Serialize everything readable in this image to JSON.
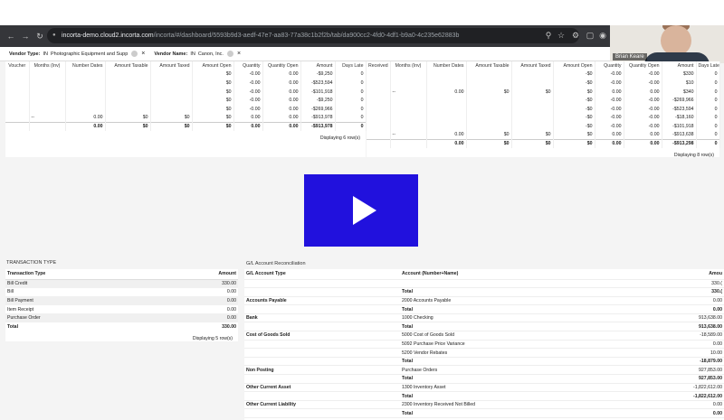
{
  "browser": {
    "url_host": "incorta-demo.cloud2.incorta.com",
    "url_path": "/incorta/#/dashboard/5593b9d3-aedf-47e7-aa83-77a38c1b2f2b/tab/da900cc2-4fd0-4df1-b9a0-4c235e62883b",
    "back_icon": "←",
    "forward_icon": "→",
    "reload_icon": "↻"
  },
  "video": {
    "participant_name": "Brian Keare"
  },
  "filters": [
    {
      "label": "Vendor Type:",
      "operator": "IN",
      "value": "Photographic Equipment and Supp"
    },
    {
      "label": "Vendor Name:",
      "operator": "IN",
      "value": "Canon, Inc."
    }
  ],
  "top_left_table": {
    "headers": [
      "Voucher",
      "Months (Inv)",
      "Number Dates",
      "Amount Taxable",
      "Amount Taxed",
      "Amount Open",
      "Quantity",
      "Quantity Open",
      "Amount",
      "Days Late"
    ],
    "rows": [
      [
        "",
        "",
        "",
        "",
        "",
        "$0",
        "-0.00",
        "0.00",
        "-$9,250",
        "0"
      ],
      [
        "",
        "",
        "",
        "",
        "",
        "$0",
        "-0.00",
        "0.00",
        "-$523,594",
        "0"
      ],
      [
        "",
        "",
        "",
        "",
        "",
        "$0",
        "-0.00",
        "0.00",
        "-$101,918",
        "0"
      ],
      [
        "",
        "",
        "",
        "",
        "",
        "$0",
        "-0.00",
        "0.00",
        "-$9,250",
        "0"
      ],
      [
        "",
        "",
        "",
        "",
        "",
        "$0",
        "-0.00",
        "0.00",
        "-$269,966",
        "0"
      ],
      [
        "",
        "--",
        "0.00",
        "$0",
        "$0",
        "$0",
        "0.00",
        "0.00",
        "-$913,978",
        "0"
      ]
    ],
    "total": [
      "",
      "",
      "0.00",
      "$0",
      "$0",
      "$0",
      "0.00",
      "0.00",
      "-$913,978",
      "0"
    ],
    "displaying": "Displaying 6 row(s)"
  },
  "top_right_table": {
    "headers": [
      "Received",
      "Months (Inv)",
      "Number Dates",
      "Amount Taxable",
      "Amount Taxed",
      "Amount Open",
      "Quantity",
      "Quantity Open",
      "Amount",
      "Days Late"
    ],
    "rows": [
      [
        "",
        "",
        "",
        "",
        "",
        "-$0",
        "-0.00",
        "-0.00",
        "$330",
        "0"
      ],
      [
        "",
        "",
        "",
        "",
        "",
        "-$0",
        "-0.00",
        "-0.00",
        "$10",
        "0"
      ],
      [
        "",
        "--",
        "0.00",
        "$0",
        "$0",
        "$0",
        "0.00",
        "0.00",
        "$340",
        "0"
      ],
      [
        "",
        "",
        "",
        "",
        "",
        "-$0",
        "-0.00",
        "-0.00",
        "-$269,966",
        "0"
      ],
      [
        "",
        "",
        "",
        "",
        "",
        "-$0",
        "-0.00",
        "-0.00",
        "-$523,594",
        "0"
      ],
      [
        "",
        "",
        "",
        "",
        "",
        "-$0",
        "-0.00",
        "-0.00",
        "-$18,160",
        "0"
      ],
      [
        "",
        "",
        "",
        "",
        "",
        "-$0",
        "-0.00",
        "-0.00",
        "-$101,918",
        "0"
      ],
      [
        "",
        "--",
        "0.00",
        "$0",
        "$0",
        "$0",
        "0.00",
        "0.00",
        "-$913,638",
        "0"
      ]
    ],
    "total": [
      "",
      "",
      "0.00",
      "$0",
      "$0",
      "$0",
      "0.00",
      "0.00",
      "-$913,298",
      "0"
    ],
    "displaying": "Displaying 8 row(s)"
  },
  "transaction_type": {
    "title": "TRANSACTION TYPE",
    "headers": [
      "Transaction Type",
      "Amount"
    ],
    "rows": [
      [
        "Bill Credit",
        "330.00"
      ],
      [
        "Bill",
        "0.00"
      ],
      [
        "Bill Payment",
        "0.00"
      ],
      [
        "Item Receipt",
        "0.00"
      ],
      [
        "Purchase Order",
        "0.00"
      ]
    ],
    "total": [
      "Total",
      "330.00"
    ],
    "displaying": "Displaying 5 row(s)"
  },
  "gl_recon": {
    "title": "G/L Account Reconciliation",
    "headers": [
      "G/L Account Type",
      "Account (Number+Name)",
      "Amou"
    ],
    "rows": [
      [
        "",
        "",
        "330.("
      ],
      [
        "",
        "Total",
        "330.("
      ],
      [
        "Accounts Payable",
        "2000 Accounts Payable",
        "0.00"
      ],
      [
        "",
        "Total",
        "0.00"
      ],
      [
        "Bank",
        "1000 Checking",
        "913,638.00"
      ],
      [
        "",
        "Total",
        "913,638.00"
      ],
      [
        "Cost of Goods Sold",
        "5000 Cost of Goods Sold",
        "-18,589.00"
      ],
      [
        "",
        "5092 Purchase Price Variance",
        "0.00"
      ],
      [
        "",
        "5200 Vendor Rebates",
        "10.00"
      ],
      [
        "",
        "Total",
        "-18,879.00"
      ],
      [
        "Non Posting",
        "Purchase Orders",
        "927,853.00"
      ],
      [
        "",
        "Total",
        "927,853.00"
      ],
      [
        "Other Current Asset",
        "1300 Inventory Asset",
        "-1,822,612.00"
      ],
      [
        "",
        "Total",
        "-1,822,612.00"
      ],
      [
        "Other Current Liability",
        "2300 Inventory Received Not Billed",
        "0.00"
      ],
      [
        "",
        "Total",
        "0.00"
      ]
    ]
  }
}
